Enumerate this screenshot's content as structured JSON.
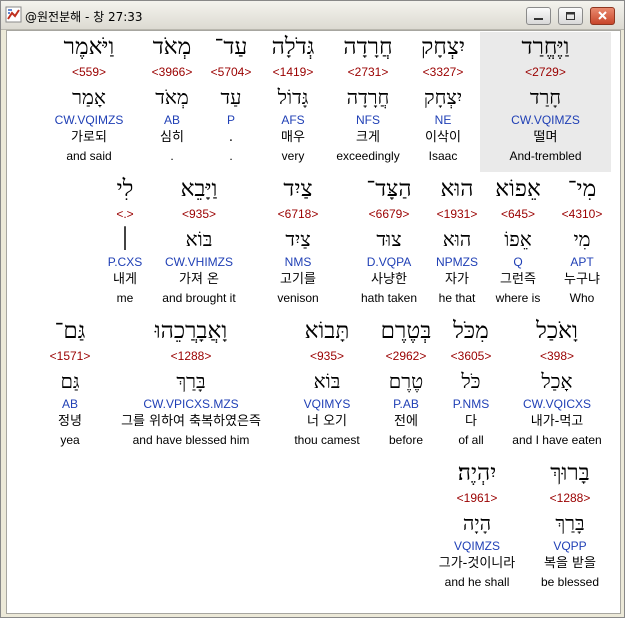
{
  "window": {
    "title": "@원전분해 - 창 27:33",
    "icon": "broken-image-icon",
    "buttons": [
      "minimize-icon",
      "maximize-icon",
      "close-icon"
    ]
  },
  "colors": {
    "strong": "#9a0000",
    "morph": "#1f3fb5",
    "selected_bg": "#eaeaea"
  },
  "rows": [
    [
      {
        "heb": "וַיֶּחֱרַד",
        "strong": "<2729>",
        "root": "חָרַד",
        "morph": "CW.VQIMZS",
        "ko": "떨며",
        "en": "And-trembled"
      },
      {
        "heb": "יִצְחָק",
        "strong": "<3327>",
        "root": "יִצְחָק",
        "morph": "NE",
        "ko": "이삭이",
        "en": "Isaac"
      },
      {
        "heb": "חֲרָדָה",
        "strong": "<2731>",
        "root": "חֲרָדָה",
        "morph": "NFS",
        "ko": "크게",
        "en": "exceedingly"
      },
      {
        "heb": "גְּדֹלָה",
        "strong": "<1419>",
        "root": "גָּדוֹל",
        "morph": "AFS",
        "ko": "매우",
        "en": "very"
      },
      {
        "heb": "עַד־",
        "strong": "<5704>",
        "root": "עַד",
        "morph": "P",
        "ko": ".",
        "en": "."
      },
      {
        "heb": "מְאֹד",
        "strong": "<3966>",
        "root": "מְאֹד",
        "morph": "AB",
        "ko": "심히",
        "en": "."
      },
      {
        "heb": "וַיֹּאמֶר",
        "strong": "<559>",
        "root": "אָמַר",
        "morph": "CW.VQIMZS",
        "ko": "가로되",
        "en": "and said"
      }
    ],
    [
      {
        "heb": "מִי־",
        "strong": "<4310>",
        "root": "מִי",
        "morph": "APT",
        "ko": "누구냐",
        "en": "Who"
      },
      {
        "heb": "אֵפוֹא",
        "strong": "<645>",
        "root": "אֵפוֹ",
        "morph": "Q",
        "ko": "그런즉",
        "en": "where is"
      },
      {
        "heb": "הוּא",
        "strong": "<1931>",
        "root": "הוּא",
        "morph": "NPMZS",
        "ko": "자가",
        "en": "he that"
      },
      {
        "heb": "הַצָּד־",
        "strong": "<6679>",
        "root": "צוּד",
        "morph": "D.VQPA",
        "ko": "사냥한",
        "en": "hath taken"
      },
      {
        "heb": "צַיִד",
        "strong": "<6718>",
        "root": "צַיִד",
        "morph": "NMS",
        "ko": "고기를",
        "en": "venison"
      },
      {
        "heb": "וַיָּבֵא",
        "strong": "<935>",
        "root": "בּוֹא",
        "morph": "CW.VHIMZS",
        "ko": "가져 온",
        "en": "and brought it"
      },
      {
        "heb": "לִי",
        "strong": "<.>",
        "root": "׀",
        "morph": "P.CXS",
        "ko": "내게",
        "en": "me"
      }
    ],
    [
      {
        "heb": "וָאֹכַל",
        "strong": "<398>",
        "root": "אָכַל",
        "morph": "CW.VQICXS",
        "ko": "내가-먹고",
        "en": "and I have eaten"
      },
      {
        "heb": "מִכֹּל",
        "strong": "<3605>",
        "root": "כֹּל",
        "morph": "P.NMS",
        "ko": "다",
        "en": "of all"
      },
      {
        "heb": "בְּטֶרֶם",
        "strong": "<2962>",
        "root": "טֶרֶם",
        "morph": "P.AB",
        "ko": "전에",
        "en": "before"
      },
      {
        "heb": "תָּבוֹא",
        "strong": "<935>",
        "root": "בּוֹא",
        "morph": "VQIMYS",
        "ko": "너 오기",
        "en": "thou camest"
      },
      {
        "heb": "וָאֲבָרֲכֵהוּ",
        "strong": "<1288>",
        "root": "בָּרַךְ",
        "morph": "CW.VPICXS.MZS",
        "ko": "그를 위하여 축복하였은즉",
        "en": "and have blessed him"
      },
      {
        "heb": "גַּם־",
        "strong": "<1571>",
        "root": "גַּם",
        "morph": "AB",
        "ko": "정녕",
        "en": "yea"
      }
    ],
    [
      {
        "heb": "בָּרוּךְ",
        "strong": "<1288>",
        "root": "בָּרַךְ",
        "morph": "VQPP",
        "ko": "복을 받을",
        "en": "be blessed"
      },
      {
        "heb": "יִהְיֶה׃",
        "strong": "<1961>",
        "root": "הָיָה",
        "morph": "VQIMZS",
        "ko": "그가-것이니라",
        "en": "and he shall"
      }
    ]
  ]
}
